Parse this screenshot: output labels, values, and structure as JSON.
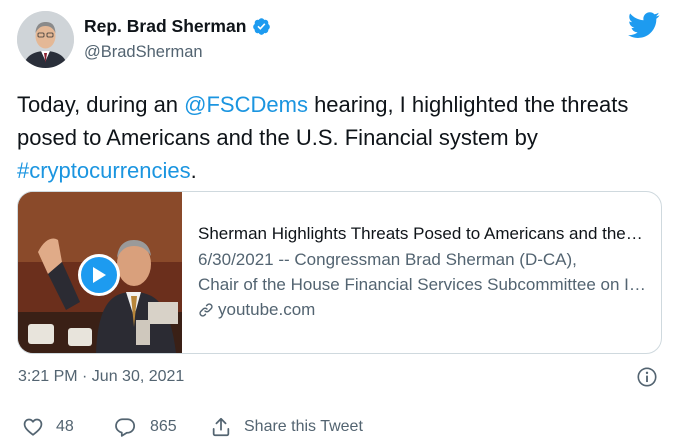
{
  "author": {
    "display_name": "Rep. Brad Sherman",
    "handle": "@BradSherman",
    "verified": true
  },
  "tweet": {
    "text_before": "Today, during an ",
    "mention": "@FSCDems",
    "text_middle": " hearing, I highlighted the threats posed to Americans and the U.S. Financial system by ",
    "hashtag": "#cryptocurrencies",
    "text_after": "."
  },
  "card": {
    "title": "Sherman Highlights Threats Posed to Americans and the U.S. Financial System",
    "description_line1": "6/30/2021 -- Congressman Brad Sherman (D-CA),",
    "description_line2": "Chair of the House Financial Services Subcommittee on Investor Protection",
    "domain": "youtube.com"
  },
  "timestamp": "3:21 PM · Jun 30, 2021",
  "actions": {
    "like_count": "48",
    "reply_count": "865",
    "share_label": "Share this Tweet"
  },
  "colors": {
    "link": "#1b95e0",
    "twitter_blue": "#1d9bf0",
    "secondary_text": "#536471"
  },
  "icons": [
    "verified-badge-icon",
    "twitter-bird-icon",
    "play-icon",
    "link-icon",
    "info-icon",
    "heart-icon",
    "reply-icon",
    "share-icon"
  ]
}
